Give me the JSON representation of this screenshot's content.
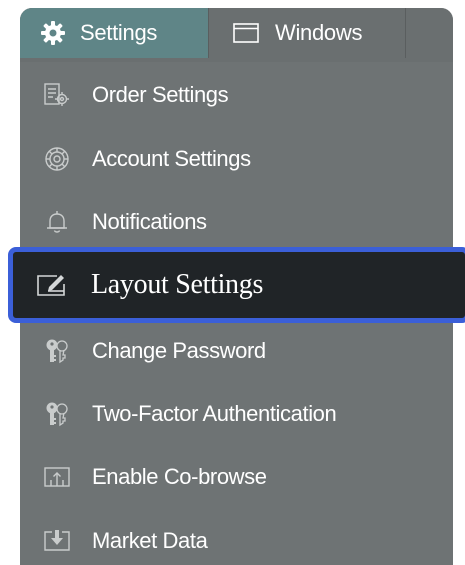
{
  "tabs": {
    "settings": {
      "label": "Settings",
      "icon": "gear-icon"
    },
    "windows": {
      "label": "Windows",
      "icon": "window-icon"
    }
  },
  "menu": {
    "items": [
      {
        "label": "Order Settings",
        "icon": "order-settings-icon"
      },
      {
        "label": "Account Settings",
        "icon": "account-settings-icon"
      },
      {
        "label": "Notifications",
        "icon": "bell-icon"
      },
      {
        "label": "Layout Settings",
        "icon": "layout-settings-icon",
        "selected": true
      },
      {
        "label": "Change Password",
        "icon": "keys-icon"
      },
      {
        "label": "Two-Factor Authentication",
        "icon": "keys-icon"
      },
      {
        "label": "Enable Co-browse",
        "icon": "co-browse-icon"
      },
      {
        "label": "Market Data",
        "icon": "market-data-icon"
      }
    ]
  },
  "colors": {
    "panel": "#6e7374",
    "active_tab": "#5f8587",
    "selected_bg": "#202427",
    "selected_border": "#3b5fd8"
  }
}
